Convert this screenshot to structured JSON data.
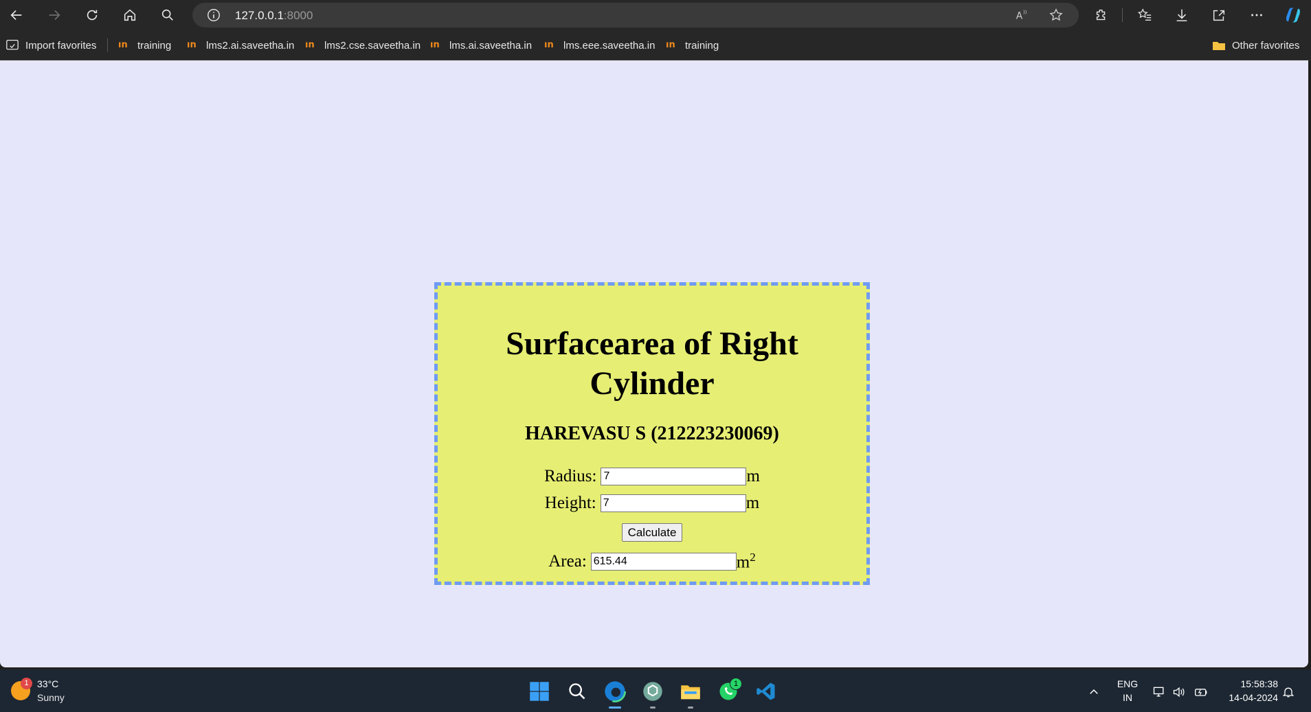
{
  "browser": {
    "address_host": "127.0.0.1",
    "address_port": ":8000",
    "bookmarks": [
      {
        "label": "Import favorites",
        "icon": "import-icon"
      },
      {
        "label": "training",
        "icon": "site-favicon"
      },
      {
        "label": "lms2.ai.saveetha.in",
        "icon": "site-favicon"
      },
      {
        "label": "lms2.cse.saveetha.in",
        "icon": "site-favicon"
      },
      {
        "label": "lms.ai.saveetha.in",
        "icon": "site-favicon"
      },
      {
        "label": "lms.eee.saveetha.in",
        "icon": "site-favicon"
      },
      {
        "label": "training",
        "icon": "site-favicon"
      }
    ],
    "other_favorites": "Other favorites"
  },
  "page": {
    "title_line1": "Surfacearea of Right",
    "title_line2": "Cylinder",
    "author": "HAREVASU S (212223230069)",
    "radius_label": "Radius:",
    "radius_value": "7",
    "radius_unit": "m",
    "height_label": "Height:",
    "height_value": "7",
    "height_unit": "m",
    "calculate_label": "Calculate",
    "area_label": "Area:",
    "area_value": "615.44",
    "area_unit": "m",
    "area_unit_power": "2",
    "colors": {
      "background": "#e6e6fa",
      "card": "#e6ee74",
      "border": "#6f9bf2"
    }
  },
  "taskbar": {
    "weather_temp": "33°C",
    "weather_desc": "Sunny",
    "weather_badge": "1",
    "whatsapp_badge": "1",
    "lang_top": "ENG",
    "lang_bottom": "IN",
    "time": "15:58:38",
    "date": "14-04-2024"
  }
}
